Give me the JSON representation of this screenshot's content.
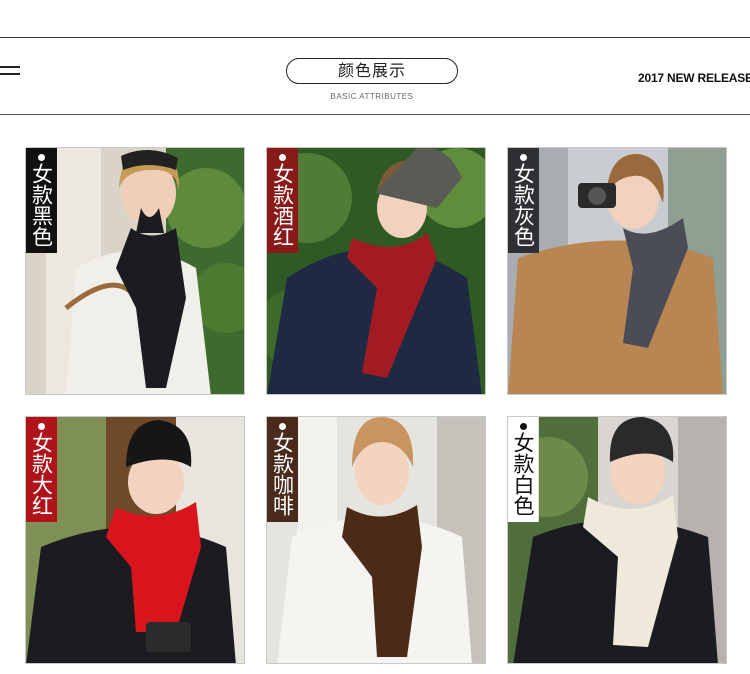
{
  "header": {
    "title": "颜色展示",
    "subtitle": "BASIC ATTRIBUTES",
    "release": "2017 NEW RELEASE"
  },
  "colors": {
    "black": "#111111",
    "wine_red": "#8a1a1a",
    "gray": "#2f3033",
    "big_red": "#b0141a",
    "coffee": "#4a2a1a",
    "white_tag": "#ffffff"
  },
  "products": [
    {
      "label": "女款黑色",
      "scarf_color": "#1a1c1f",
      "tag_color": "#111111"
    },
    {
      "label": "女款酒红",
      "scarf_color": "#a31b22",
      "tag_color": "#8a1a1a"
    },
    {
      "label": "女款灰色",
      "scarf_color": "#4a4d55",
      "tag_color": "#2f3033"
    },
    {
      "label": "女款大红",
      "scarf_color": "#d8141c",
      "tag_color": "#b0141a"
    },
    {
      "label": "女款咖啡",
      "scarf_color": "#4b2a18",
      "tag_color": "#4a2a1a"
    },
    {
      "label": "女款白色",
      "scarf_color": "#efe9dc",
      "tag_color": "#ffffff"
    }
  ]
}
